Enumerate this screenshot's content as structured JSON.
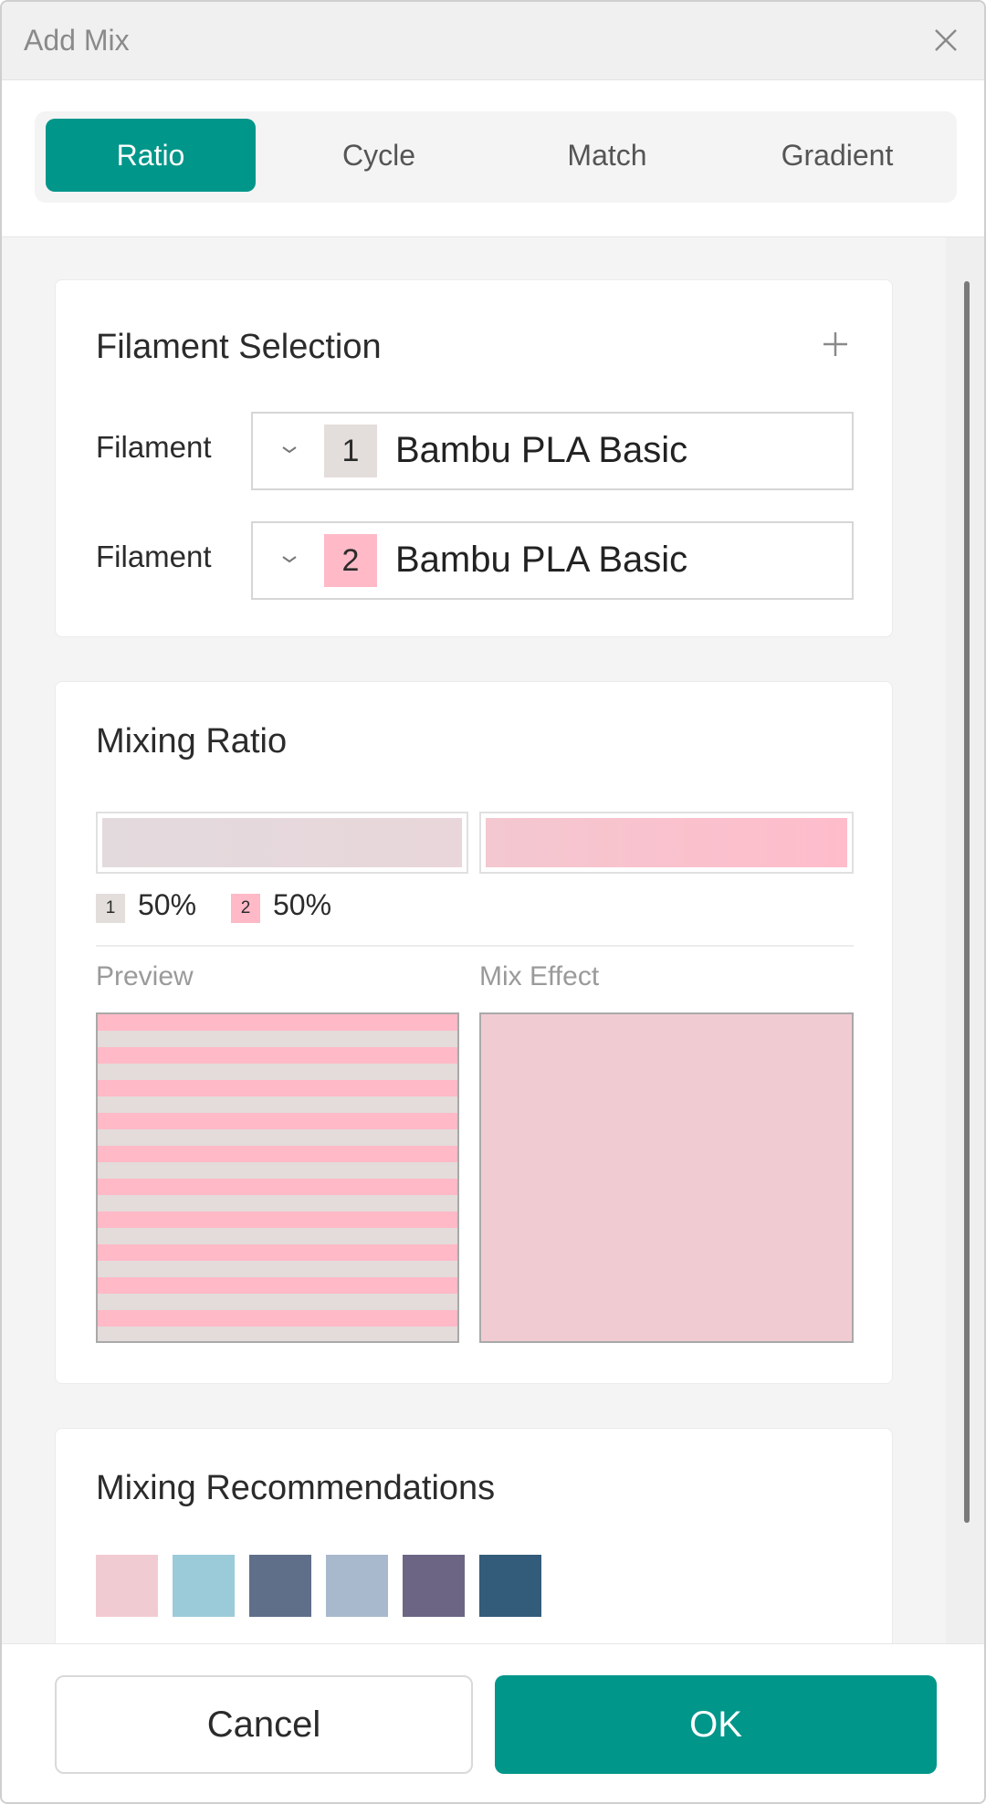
{
  "dialog": {
    "title": "Add Mix",
    "close_icon": "close-icon"
  },
  "tabs": [
    {
      "label": "Ratio",
      "active": true
    },
    {
      "label": "Cycle",
      "active": false
    },
    {
      "label": "Match",
      "active": false
    },
    {
      "label": "Gradient",
      "active": false
    }
  ],
  "filament_selection": {
    "title": "Filament Selection",
    "add_icon": "plus-icon",
    "rows": [
      {
        "label": "Filament",
        "index": "1",
        "name": "Bambu PLA Basic",
        "color": "#e3dedb"
      },
      {
        "label": "Filament",
        "index": "2",
        "name": "Bambu PLA Basic",
        "color": "#ffb9c7"
      }
    ]
  },
  "mixing_ratio": {
    "title": "Mixing Ratio",
    "parts": [
      {
        "index": "1",
        "percent": "50%",
        "color": "#e3dedb"
      },
      {
        "index": "2",
        "percent": "50%",
        "color": "#ffb9c7"
      }
    ],
    "preview_label": "Preview",
    "mix_effect_label": "Mix Effect",
    "mix_effect_color": "#f0ccd2"
  },
  "recommendations": {
    "title": "Mixing Recommendations",
    "swatches": [
      "#f1cbd2",
      "#9bcbd9",
      "#5f6f89",
      "#a8b8cd",
      "#6c6584",
      "#335b7a"
    ]
  },
  "footer": {
    "cancel_label": "Cancel",
    "ok_label": "OK"
  },
  "accent_color": "#00968a"
}
